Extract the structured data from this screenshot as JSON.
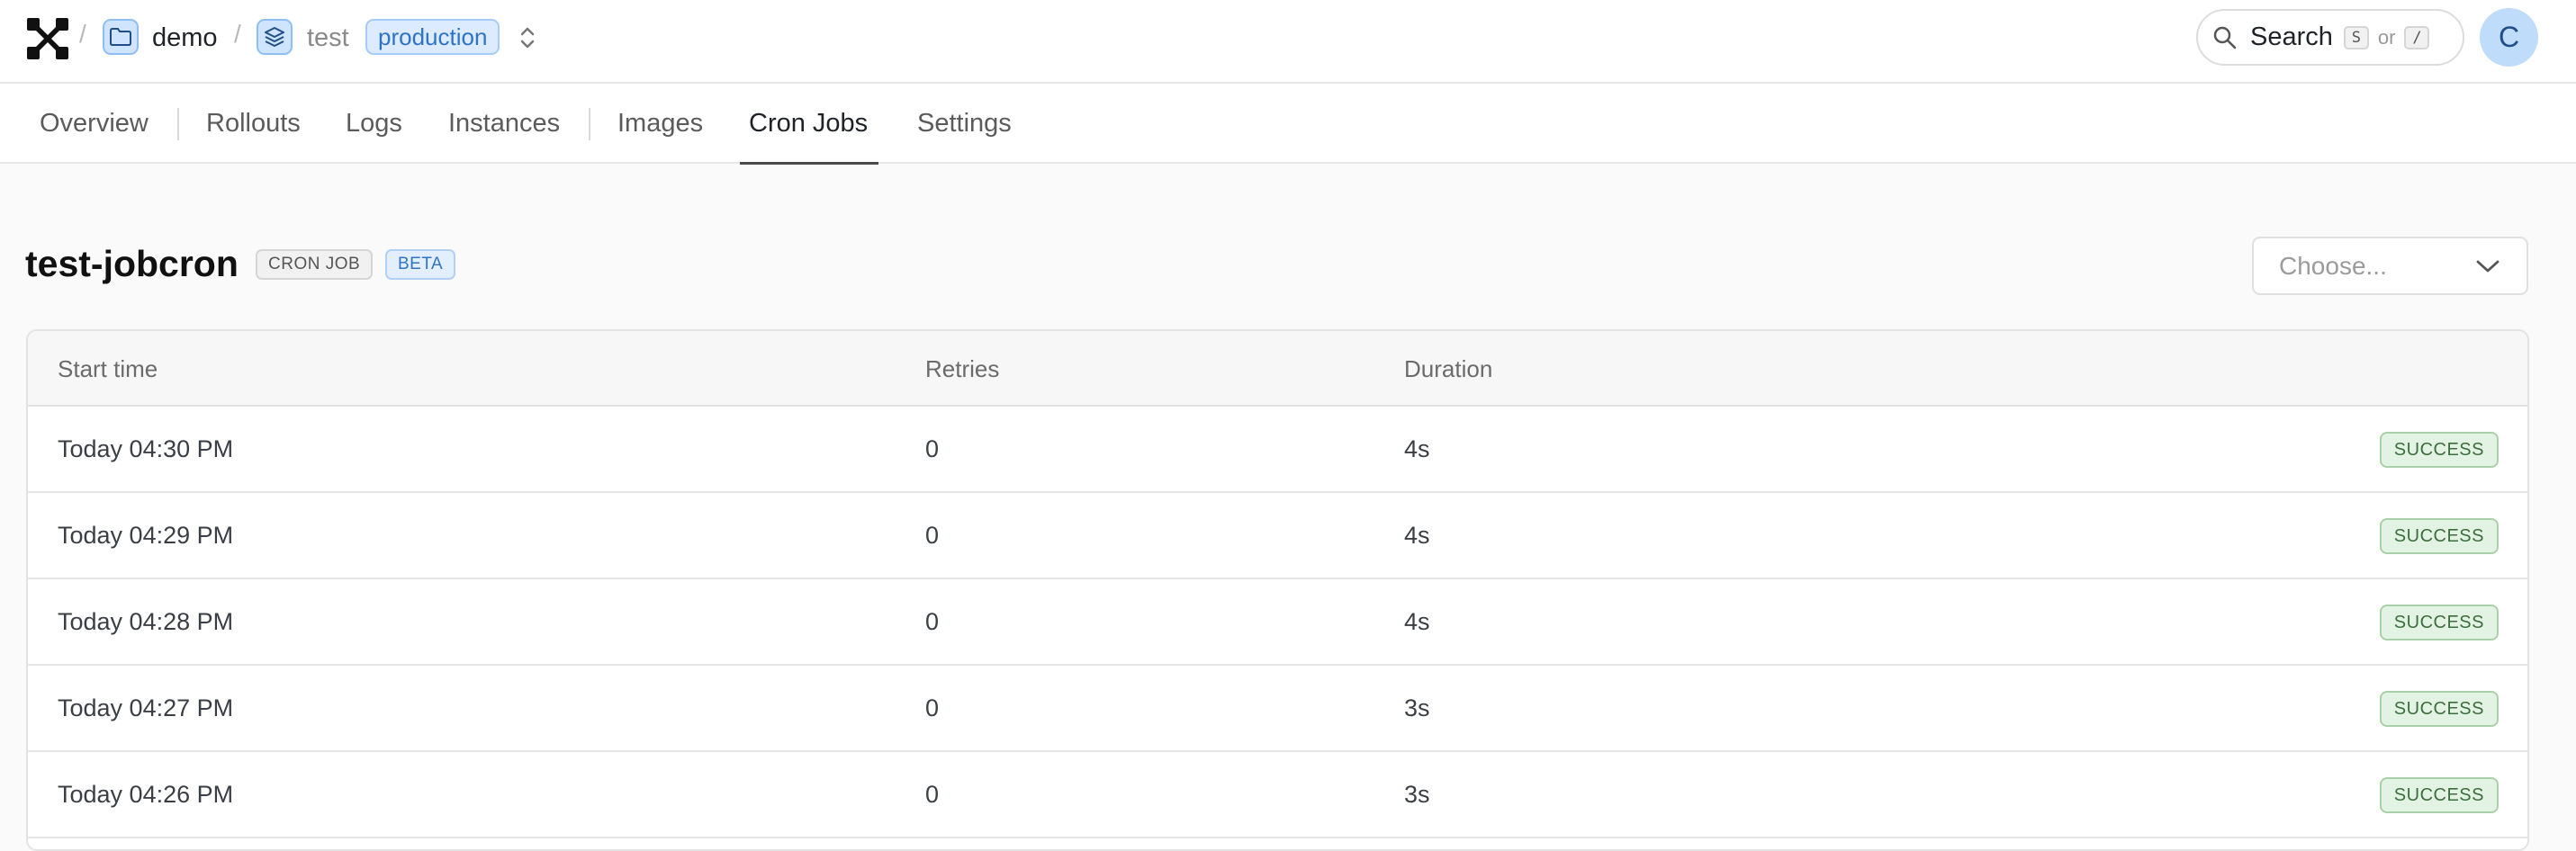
{
  "header": {
    "breadcrumb_sep": "/",
    "project_name": "demo",
    "service_name": "test",
    "environment": "production",
    "search": {
      "label": "Search",
      "key1": "S",
      "or_text": "or",
      "key2": "/"
    },
    "avatar_initial": "C"
  },
  "tabs": [
    {
      "label": "Overview"
    },
    {
      "label": "Rollouts"
    },
    {
      "label": "Logs"
    },
    {
      "label": "Instances"
    },
    {
      "label": "Images"
    },
    {
      "label": "Cron Jobs",
      "active": true
    },
    {
      "label": "Settings"
    }
  ],
  "page": {
    "title": "test-jobcron",
    "type_tag": "CRON JOB",
    "beta_tag": "BETA",
    "select_placeholder": "Choose..."
  },
  "table": {
    "columns": {
      "start_time": "Start time",
      "retries": "Retries",
      "duration": "Duration"
    },
    "rows": [
      {
        "start_time": "Today 04:30 PM",
        "retries": "0",
        "duration": "4s",
        "status": "SUCCESS"
      },
      {
        "start_time": "Today 04:29 PM",
        "retries": "0",
        "duration": "4s",
        "status": "SUCCESS"
      },
      {
        "start_time": "Today 04:28 PM",
        "retries": "0",
        "duration": "4s",
        "status": "SUCCESS"
      },
      {
        "start_time": "Today 04:27 PM",
        "retries": "0",
        "duration": "3s",
        "status": "SUCCESS"
      },
      {
        "start_time": "Today 04:26 PM",
        "retries": "0",
        "duration": "3s",
        "status": "SUCCESS"
      }
    ]
  },
  "colors": {
    "accent": "#2f73c5",
    "success_bg": "#e3f3e3",
    "success_text": "#3c6e3c"
  }
}
